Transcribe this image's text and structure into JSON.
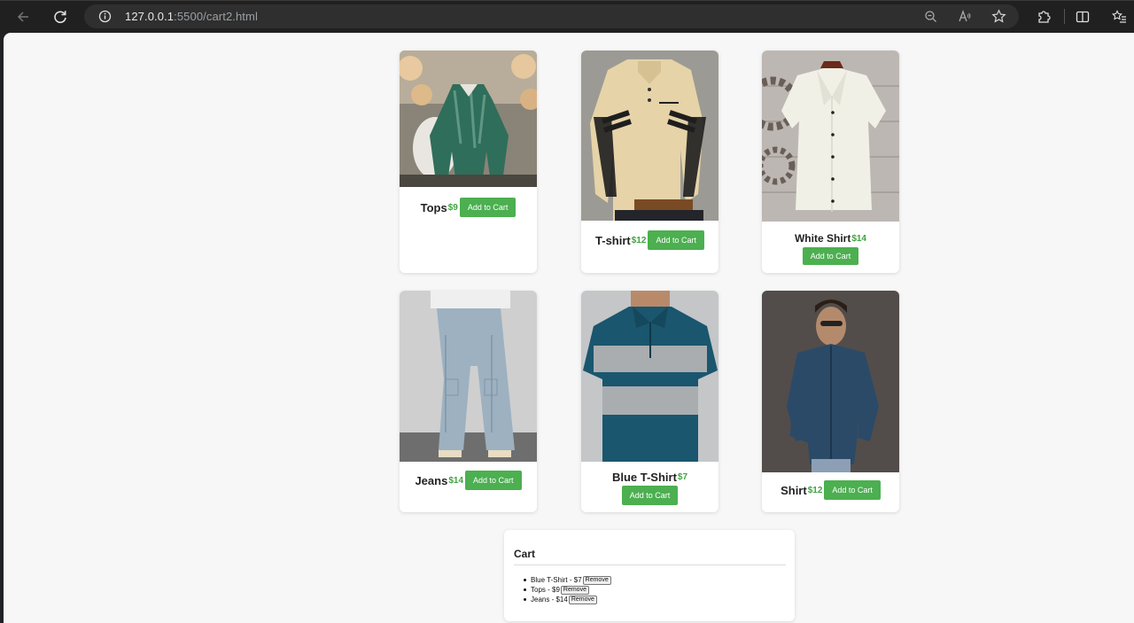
{
  "browser": {
    "url_host": "127.0.0.1",
    "url_rest": ":5500/cart2.html"
  },
  "products": [
    {
      "name": "Tops",
      "price": "$9",
      "button": "Add to Cart"
    },
    {
      "name": "T-shirt",
      "price": "$12",
      "button": "Add to Cart"
    },
    {
      "name": "White Shirt",
      "price": "$14",
      "button": "Add to Cart"
    },
    {
      "name": "Jeans",
      "price": "$14",
      "button": "Add to Cart"
    },
    {
      "name": "Blue T-Shirt",
      "price": "$7",
      "button": "Add to Cart"
    },
    {
      "name": "Shirt",
      "price": "$12",
      "button": "Add to Cart"
    }
  ],
  "cart": {
    "title": "Cart",
    "items": [
      {
        "text": "Blue T-Shirt - $7",
        "remove": "Remove"
      },
      {
        "text": "Tops - $9",
        "remove": "Remove"
      },
      {
        "text": "Jeans - $14",
        "remove": "Remove"
      }
    ]
  },
  "colors": {
    "accent": "#4caf50",
    "price": "#3fa33f",
    "page_bg": "#f7f7f7",
    "chrome_bg": "#202020"
  }
}
